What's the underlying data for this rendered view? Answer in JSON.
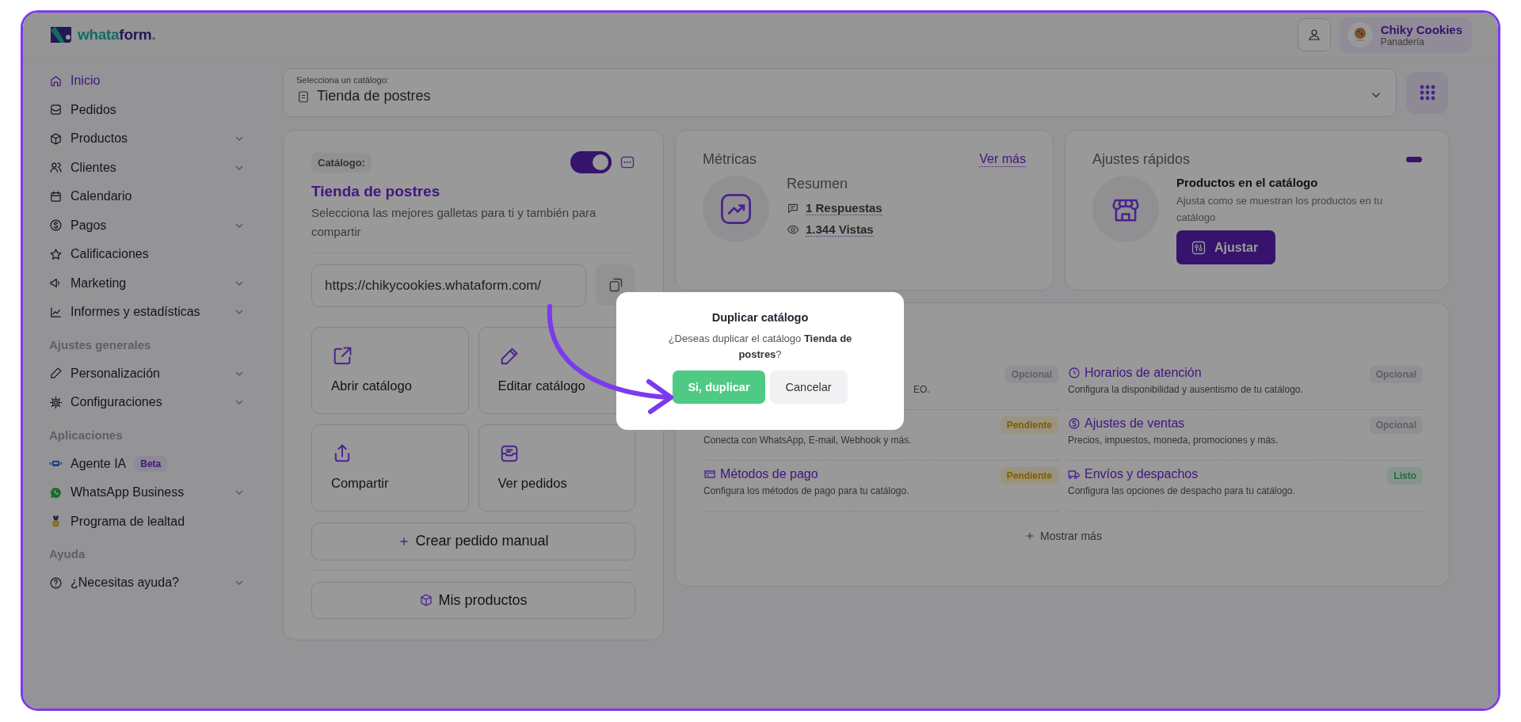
{
  "header": {
    "logo_parts": [
      "whata",
      "form",
      "."
    ],
    "user": {
      "name": "Chiky Cookies",
      "role": "Panadería"
    }
  },
  "sidebar": {
    "sections": [
      {
        "items": [
          {
            "label": "Inicio",
            "selected": true,
            "expandable": false
          },
          {
            "label": "Pedidos",
            "selected": false,
            "expandable": false
          },
          {
            "label": "Productos",
            "selected": false,
            "expandable": true
          },
          {
            "label": "Clientes",
            "selected": false,
            "expandable": true
          },
          {
            "label": "Calendario",
            "selected": false,
            "expandable": false
          },
          {
            "label": "Pagos",
            "selected": false,
            "expandable": true
          },
          {
            "label": "Calificaciones",
            "selected": false,
            "expandable": false
          },
          {
            "label": "Marketing",
            "selected": false,
            "expandable": true
          },
          {
            "label": "Informes y estadísticas",
            "selected": false,
            "expandable": true
          }
        ]
      },
      {
        "heading": "Ajustes generales",
        "items": [
          {
            "label": "Personalización",
            "selected": false,
            "expandable": true
          },
          {
            "label": "Configuraciones",
            "selected": false,
            "expandable": true
          }
        ]
      },
      {
        "heading": "Aplicaciones",
        "items": [
          {
            "label": "Agente IA",
            "badge": "Beta",
            "selected": false,
            "expandable": false
          },
          {
            "label": "WhatsApp Business",
            "selected": false,
            "expandable": true
          },
          {
            "label": "Programa de lealtad",
            "selected": false,
            "expandable": false
          }
        ]
      },
      {
        "heading": "Ayuda",
        "items": [
          {
            "label": "¿Necesitas ayuda?",
            "selected": false,
            "expandable": true
          }
        ]
      }
    ]
  },
  "catalog_select": {
    "label": "Selecciona un catálogo:",
    "value": "Tienda de postres"
  },
  "catalog": {
    "tag": "Catálogo:",
    "active": true,
    "title": "Tienda de postres",
    "description": "Selecciona las mejores galletas para ti y también para compartir",
    "url": "https://chikycookies.whataform.com/",
    "actions": [
      "Abrir catálogo",
      "Editar catálogo",
      "Compartir",
      "Ver pedidos"
    ],
    "create_button": "Crear pedido manual",
    "products_button": "Mis productos"
  },
  "metrics": {
    "title": "Métricas",
    "link": "Ver más",
    "subtitle": "Resumen",
    "stats": [
      "1 Respuestas",
      "1.344 Vistas"
    ]
  },
  "quick_settings": {
    "title": "Ajustes rápidos",
    "item_title": "Productos en el catálogo",
    "item_description": "Ajusta como se muestran los productos en tu catálogo",
    "button": "Ajustar"
  },
  "checklist": {
    "items": [
      {
        "kind": "partial",
        "description": "EO.",
        "badge": {
          "label": "Opcional",
          "kind": "optional"
        }
      },
      {
        "kind": "full",
        "title": "Horarios de atención",
        "description": "Configura la disponibilidad y ausentismo de tu catálogo.",
        "badge": {
          "label": "Opcional",
          "kind": "optional"
        }
      },
      {
        "kind": "partial",
        "description": "Conecta con WhatsApp, E-mail, Webhook y más.",
        "badge": {
          "label": "Pendiente",
          "kind": "pending"
        }
      },
      {
        "kind": "full",
        "title": "Ajustes de ventas",
        "description": "Precios, impuestos, moneda, promociones y más.",
        "badge": {
          "label": "Opcional",
          "kind": "optional"
        }
      },
      {
        "kind": "full",
        "title": "Métodos de pago",
        "description": "Configura los métodos de pago para tu catálogo.",
        "badge": {
          "label": "Pendiente",
          "kind": "pending"
        }
      },
      {
        "kind": "full",
        "title": "Envíos y despachos",
        "description": "Configura las opciones de despacho para tu catálogo.",
        "badge": {
          "label": "Listo",
          "kind": "done"
        }
      }
    ],
    "more": "Mostrar más"
  },
  "modal": {
    "title": "Duplicar catálogo",
    "message": "¿Deseas duplicar el catálogo **Tienda de postres**?",
    "confirm": "Si, duplicar",
    "cancel": "Cancelar"
  }
}
